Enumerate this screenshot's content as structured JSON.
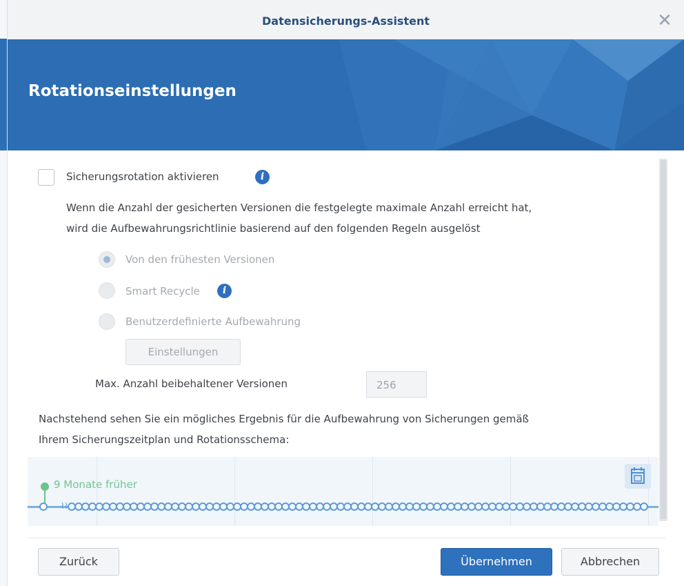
{
  "window": {
    "title": "Datensicherungs-Assistent",
    "close_icon": "close-icon"
  },
  "banner": {
    "title": "Rotationseinstellungen",
    "color": "#2c6db3"
  },
  "rotation": {
    "enable_label": "Sicherungsrotation aktivieren",
    "enabled": false,
    "description_line1": "Wenn die Anzahl der gesicherten Versionen die festgelegte maximale Anzahl erreicht hat,",
    "description_line2": "wird die Aufbewahrungsrichtlinie basierend auf den folgenden Regeln ausgelöst",
    "options": [
      {
        "label": "Von den frühesten Versionen",
        "selected": true
      },
      {
        "label": "Smart Recycle",
        "selected": false,
        "info_icon": "info-icon"
      },
      {
        "label": "Benutzerdefinierte Aufbewahrung",
        "selected": false
      }
    ],
    "settings_button": "Einstellungen",
    "max_versions_label": "Max. Anzahl beibehaltener Versionen",
    "max_versions_value": "256"
  },
  "preview": {
    "text_line1": "Nachstehend sehen Sie ein mögliches Ergebnis für die Aufbewahrung von Sicherungen gemäß",
    "text_line2": "Ihrem Sicherungszeitplan und Rotationsschema:",
    "timeline_label": "9 Monate früher",
    "calendar_icon": "calendar-icon"
  },
  "footer": {
    "back_label": "Zurück",
    "apply_label": "Übernehmen",
    "cancel_label": "Abbrechen"
  },
  "colors": {
    "accent": "#2e71bd",
    "timeline_green": "#6dc28e",
    "timeline_blue": "#5d9ad6"
  }
}
